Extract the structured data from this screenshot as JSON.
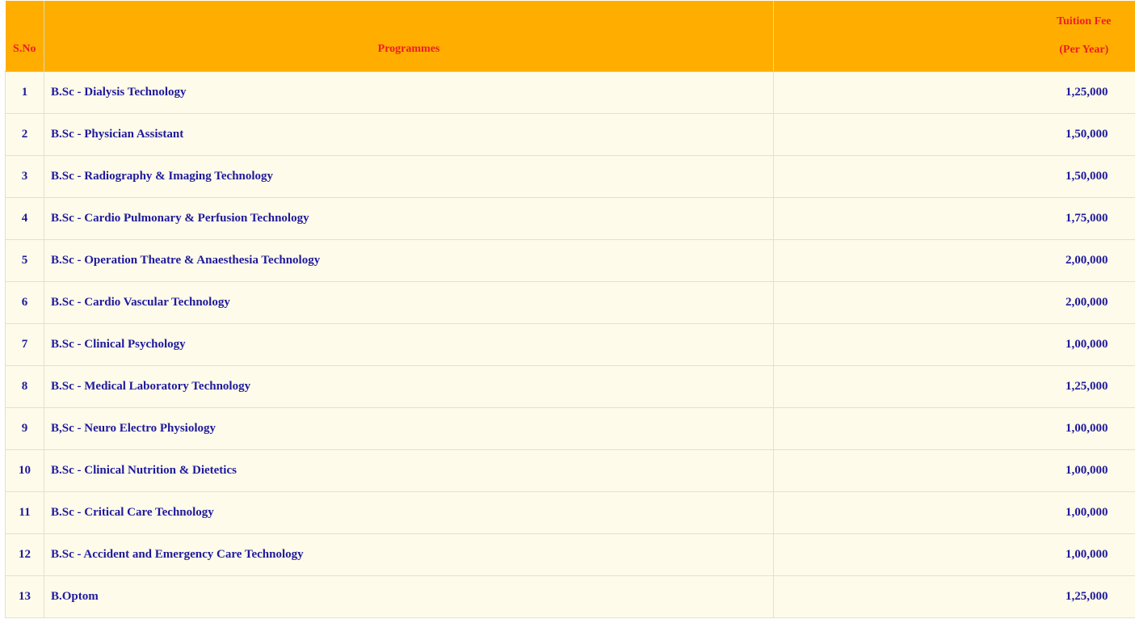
{
  "table": {
    "headers": {
      "sno": "S.No",
      "programmes": "Programmes",
      "fee_line1": "Tuition Fee",
      "fee_line2": "(Per Year)"
    },
    "rows": [
      {
        "sno": "1",
        "programme": "B.Sc - Dialysis Technology",
        "fee": "1,25,000"
      },
      {
        "sno": "2",
        "programme": "B.Sc - Physician Assistant",
        "fee": "1,50,000"
      },
      {
        "sno": "3",
        "programme": "B.Sc - Radiography & Imaging Technology",
        "fee": "1,50,000"
      },
      {
        "sno": "4",
        "programme": "B.Sc - Cardio Pulmonary & Perfusion Technology",
        "fee": "1,75,000"
      },
      {
        "sno": "5",
        "programme": "B.Sc - Operation Theatre & Anaesthesia Technology",
        "fee": "2,00,000"
      },
      {
        "sno": "6",
        "programme": "B.Sc - Cardio Vascular Technology",
        "fee": "2,00,000"
      },
      {
        "sno": "7",
        "programme": "B.Sc - Clinical Psychology",
        "fee": "1,00,000"
      },
      {
        "sno": "8",
        "programme": "B.Sc - Medical Laboratory Technology",
        "fee": "1,25,000"
      },
      {
        "sno": "9",
        "programme": "B,Sc - Neuro Electro Physiology",
        "fee": "1,00,000"
      },
      {
        "sno": "10",
        "programme": "B.Sc - Clinical Nutrition & Dietetics",
        "fee": "1,00,000"
      },
      {
        "sno": "11",
        "programme": "B.Sc - Critical Care Technology",
        "fee": "1,00,000"
      },
      {
        "sno": "12",
        "programme": "B.Sc - Accident and Emergency Care Technology",
        "fee": "1,00,000"
      },
      {
        "sno": "13",
        "programme": "B.Optom",
        "fee": "1,25,000"
      }
    ]
  },
  "colors": {
    "header_bg": "#ffae00",
    "header_text": "#ee1c25",
    "row_bg": "#fffbea",
    "row_text": "#1e1a9c"
  }
}
